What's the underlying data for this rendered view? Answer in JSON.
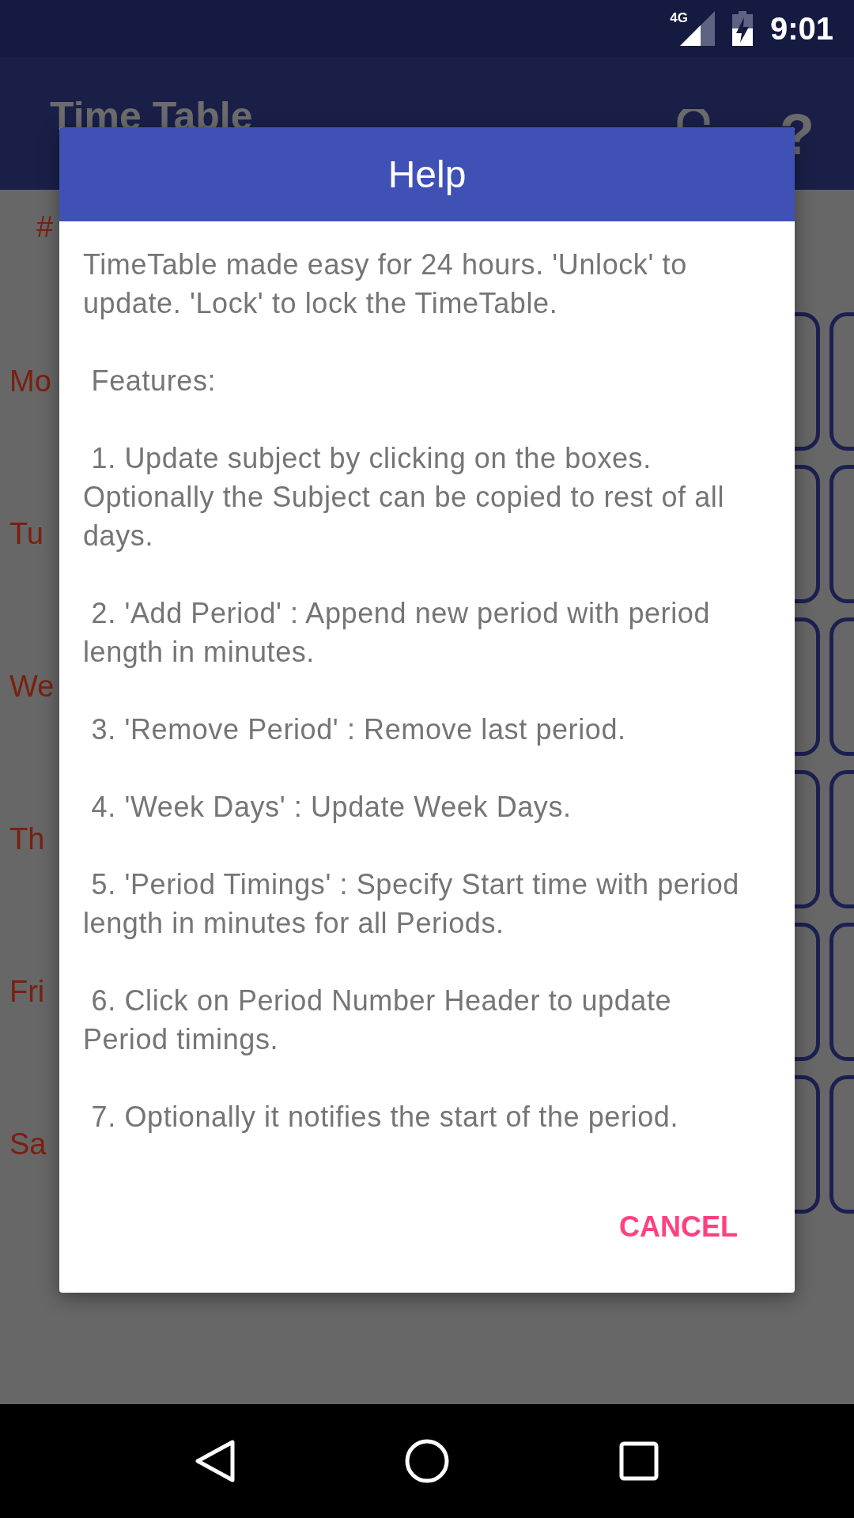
{
  "status_bar": {
    "network": "4G",
    "time": "9:01"
  },
  "app_bar": {
    "title": "Time Table",
    "help_label": "?"
  },
  "timetable": {
    "header": "#",
    "days": [
      "Mo",
      "Tu",
      "We",
      "Th",
      "Fri",
      "Sa"
    ]
  },
  "dialog": {
    "title": "Help",
    "paragraphs": [
      "TimeTable made easy for 24 hours. 'Unlock' to update. 'Lock' to lock the TimeTable.",
      " Features:",
      " 1. Update subject by clicking on the boxes. Optionally the Subject can be copied to rest of all days.",
      " 2. 'Add Period' : Append new period with period length in minutes.",
      " 3. 'Remove Period' : Remove last period.",
      " 4. 'Week Days' : Update Week Days.",
      " 5. 'Period Timings' : Specify Start time with period length in minutes for all Periods.",
      " 6. Click on Period Number Header to update Period timings.",
      " 7. Optionally it notifies the start of the period."
    ],
    "buttons": [
      "CANCEL"
    ]
  }
}
